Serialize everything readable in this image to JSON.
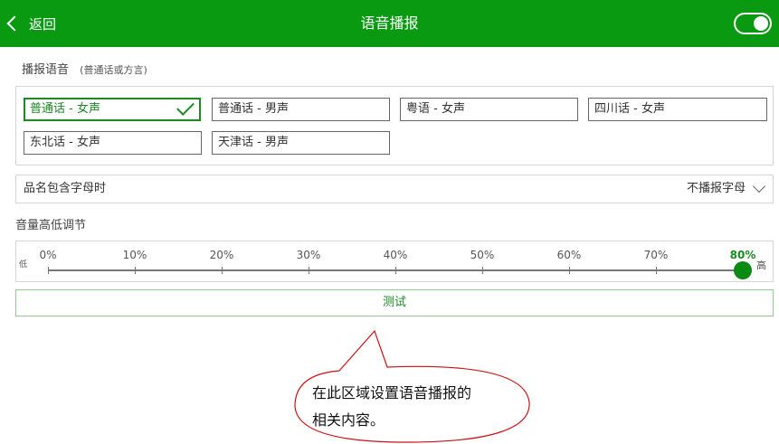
{
  "header": {
    "back_label": "返回",
    "title": "语音播报",
    "toggle_on": true
  },
  "voice_section": {
    "title": "播报语音",
    "subtitle": "(普通话或方言)",
    "options": [
      {
        "label": "普通话 - 女声",
        "selected": true
      },
      {
        "label": "普通话 - 男声",
        "selected": false
      },
      {
        "label": "粤语 - 女声",
        "selected": false
      },
      {
        "label": "四川话 - 女声",
        "selected": false
      },
      {
        "label": "东北话 - 女声",
        "selected": false
      },
      {
        "label": "天津话 - 男声",
        "selected": false
      }
    ]
  },
  "letter_setting": {
    "label": "品名包含字母时",
    "value": "不播报字母"
  },
  "volume": {
    "title": "音量高低调节",
    "low_label": "低",
    "high_label": "高",
    "ticks": [
      "0%",
      "10%",
      "20%",
      "30%",
      "40%",
      "50%",
      "60%",
      "70%",
      "80%"
    ],
    "value_percent": 80
  },
  "test_button": {
    "label": "测试"
  },
  "annotation": {
    "line1": "在此区域设置语音播报的",
    "line2": "相关内容。"
  },
  "colors": {
    "header_bg": "#0a9a12",
    "accent": "#1a8a22",
    "callout_border": "#cc1111"
  }
}
